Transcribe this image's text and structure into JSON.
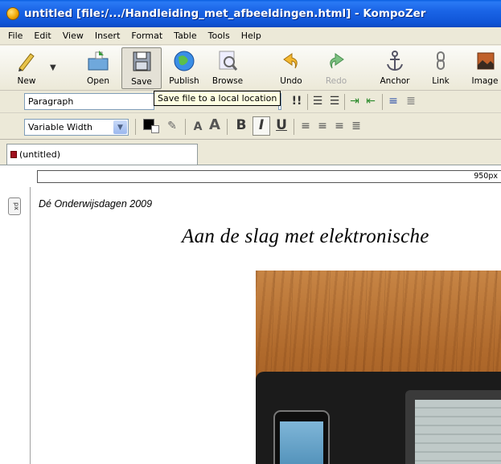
{
  "window": {
    "title": "untitled [file:/.../Handleiding_met_afbeeldingen.html] - KompoZer"
  },
  "menu": [
    "File",
    "Edit",
    "View",
    "Insert",
    "Format",
    "Table",
    "Tools",
    "Help"
  ],
  "toolbar": {
    "buttons": [
      {
        "label": "New",
        "icon": "pencil-icon"
      },
      {
        "label": "Open",
        "icon": "open-folder-icon"
      },
      {
        "label": "Save",
        "icon": "floppy-disk-icon"
      },
      {
        "label": "Publish",
        "icon": "globe-icon"
      },
      {
        "label": "Browse",
        "icon": "magnifier-icon"
      },
      {
        "label": "Undo",
        "icon": "undo-arrow-icon"
      },
      {
        "label": "Redo",
        "icon": "redo-arrow-icon"
      },
      {
        "label": "Anchor",
        "icon": "anchor-icon"
      },
      {
        "label": "Link",
        "icon": "chain-link-icon"
      },
      {
        "label": "Image",
        "icon": "picture-icon"
      }
    ],
    "tooltip": "Save file to a local location"
  },
  "format": {
    "paragraph_select": "Paragraph",
    "font_select": "Variable Width"
  },
  "tab": {
    "label": "(untitled)"
  },
  "ruler": {
    "width_label": "950px"
  },
  "gutter": {
    "px_badge": "px"
  },
  "document": {
    "subtitle": "Dé Onderwijsdagen 2009",
    "heading": "Aan de slag met elektronische"
  },
  "colors": {
    "titlebar": "#1a64e6",
    "chrome": "#ece9d8",
    "tooltip_bg": "#ffffe1"
  }
}
